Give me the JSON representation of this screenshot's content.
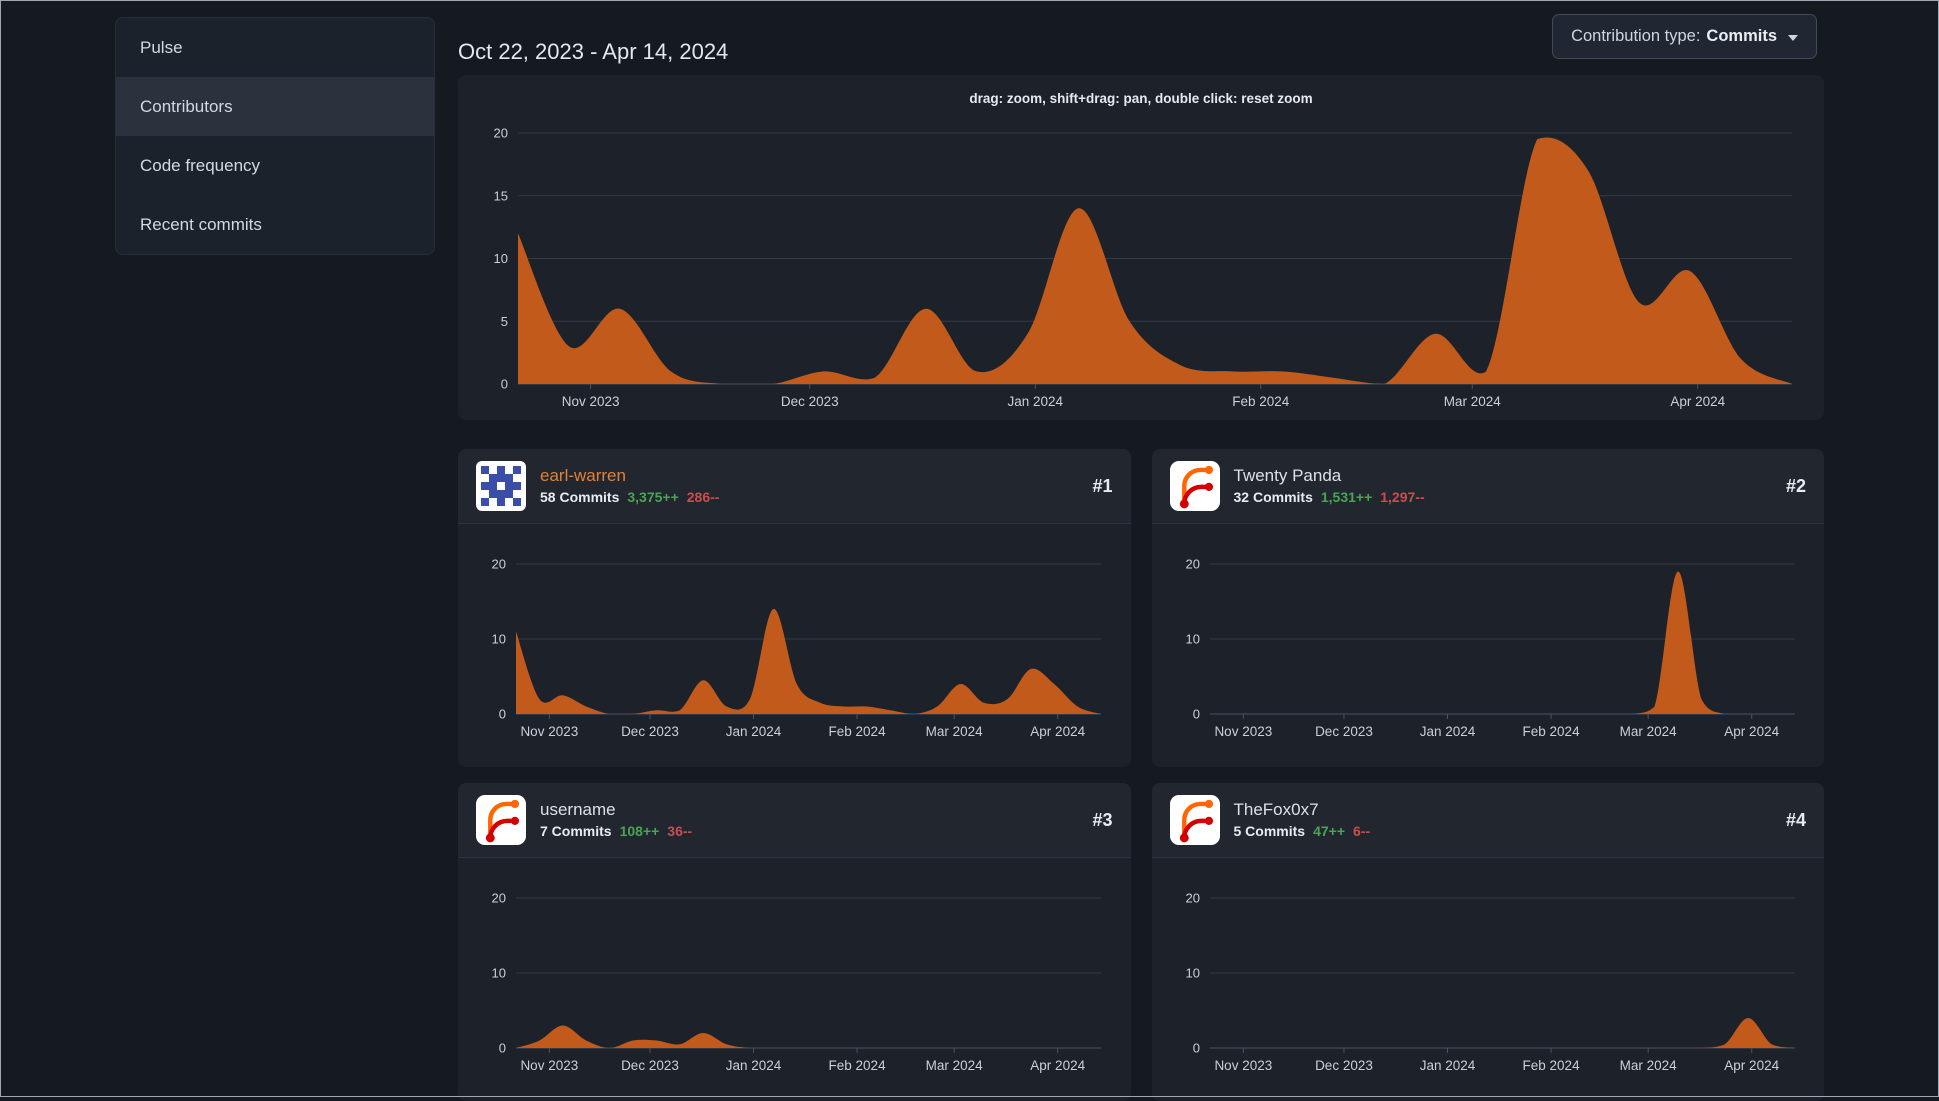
{
  "sidebar": {
    "items": [
      {
        "label": "Pulse",
        "active": false
      },
      {
        "label": "Contributors",
        "active": true
      },
      {
        "label": "Code frequency",
        "active": false
      },
      {
        "label": "Recent commits",
        "active": false
      }
    ]
  },
  "header": {
    "date_range": "Oct 22, 2023 - Apr 14, 2024",
    "contribution_type": {
      "label": "Contribution type:",
      "value": "Commits"
    }
  },
  "main_chart": {
    "hint": "drag: zoom, shift+drag: pan, double click: reset zoom"
  },
  "contributors": [
    {
      "rank": "#1",
      "name": "earl-warren",
      "name_color": "#e0813c",
      "commits": "58 Commits",
      "additions": "3,375++",
      "deletions": "286--",
      "avatar": "identicon"
    },
    {
      "rank": "#2",
      "name": "Twenty Panda",
      "name_color": "#dbe1e9",
      "commits": "32 Commits",
      "additions": "1,531++",
      "deletions": "1,297--",
      "avatar": "forgejo-logo"
    },
    {
      "rank": "#3",
      "name": "username",
      "name_color": "#dbe1e9",
      "commits": "7 Commits",
      "additions": "108++",
      "deletions": "36--",
      "avatar": "forgejo-logo"
    },
    {
      "rank": "#4",
      "name": "TheFox0x7",
      "name_color": "#dbe1e9",
      "commits": "5 Commits",
      "additions": "47++",
      "deletions": "6--",
      "avatar": "forgejo-logo"
    }
  ],
  "colors": {
    "area_fill": "#c25a1b",
    "additions_green": "#4aa454",
    "deletions_red": "#c94f4f",
    "link_orange": "#e0813c",
    "panel_bg": "#1c212a",
    "page_bg": "#151a21"
  },
  "chart_data": [
    {
      "name": "overall-commits",
      "type": "area",
      "point_interval": "week",
      "ymax": 20,
      "yticks": [
        0,
        5,
        10,
        15,
        20
      ],
      "xticks": [
        {
          "label": "Nov 2023",
          "f": 0.057
        },
        {
          "label": "Dec 2023",
          "f": 0.229
        },
        {
          "label": "Jan 2024",
          "f": 0.406
        },
        {
          "label": "Feb 2024",
          "f": 0.583
        },
        {
          "label": "Mar 2024",
          "f": 0.749
        },
        {
          "label": "Apr 2024",
          "f": 0.926
        }
      ],
      "values": [
        12,
        3,
        6,
        1,
        0,
        0,
        1,
        0.5,
        6,
        1,
        4,
        14,
        5,
        1.5,
        1,
        1,
        0.5,
        0,
        4,
        1,
        19.5,
        17,
        6.5,
        9,
        2,
        0
      ]
    },
    {
      "name": "earl-warren-commits",
      "type": "area",
      "point_interval": "week",
      "ymax": 20,
      "yticks": [
        0,
        10,
        20
      ],
      "xticks": [
        {
          "label": "Nov 2023",
          "f": 0.057
        },
        {
          "label": "Dec 2023",
          "f": 0.229
        },
        {
          "label": "Jan 2024",
          "f": 0.406
        },
        {
          "label": "Feb 2024",
          "f": 0.583
        },
        {
          "label": "Mar 2024",
          "f": 0.749
        },
        {
          "label": "Apr 2024",
          "f": 0.926
        }
      ],
      "values": [
        11,
        2,
        2.5,
        1,
        0,
        0,
        0.5,
        0.5,
        4.5,
        1,
        2,
        14,
        4,
        1.5,
        1,
        1,
        0.5,
        0,
        1,
        4,
        1.5,
        2,
        6,
        4,
        1,
        0
      ]
    },
    {
      "name": "twenty-panda-commits",
      "type": "area",
      "point_interval": "week",
      "ymax": 20,
      "yticks": [
        0,
        10,
        20
      ],
      "xticks": [
        {
          "label": "Nov 2023",
          "f": 0.057
        },
        {
          "label": "Dec 2023",
          "f": 0.229
        },
        {
          "label": "Jan 2024",
          "f": 0.406
        },
        {
          "label": "Feb 2024",
          "f": 0.583
        },
        {
          "label": "Mar 2024",
          "f": 0.749
        },
        {
          "label": "Apr 2024",
          "f": 0.926
        }
      ],
      "values": [
        0,
        0,
        0,
        0,
        0,
        0,
        0,
        0,
        0,
        0,
        0,
        0,
        0,
        0,
        0,
        0,
        0,
        0,
        0,
        1,
        19,
        2,
        0,
        0,
        0,
        0
      ]
    },
    {
      "name": "username-commits",
      "type": "area",
      "point_interval": "week",
      "ymax": 20,
      "yticks": [
        0,
        10,
        20
      ],
      "xticks": [
        {
          "label": "Nov 2023",
          "f": 0.057
        },
        {
          "label": "Dec 2023",
          "f": 0.229
        },
        {
          "label": "Jan 2024",
          "f": 0.406
        },
        {
          "label": "Feb 2024",
          "f": 0.583
        },
        {
          "label": "Mar 2024",
          "f": 0.749
        },
        {
          "label": "Apr 2024",
          "f": 0.926
        }
      ],
      "values": [
        0,
        1,
        3,
        1,
        0,
        1,
        1,
        0.5,
        2,
        0.5,
        0,
        0,
        0,
        0,
        0,
        0,
        0,
        0,
        0,
        0,
        0,
        0,
        0,
        0,
        0,
        0
      ]
    },
    {
      "name": "thefox0x7-commits",
      "type": "area",
      "point_interval": "week",
      "ymax": 20,
      "yticks": [
        0,
        10,
        20
      ],
      "xticks": [
        {
          "label": "Nov 2023",
          "f": 0.057
        },
        {
          "label": "Dec 2023",
          "f": 0.229
        },
        {
          "label": "Jan 2024",
          "f": 0.406
        },
        {
          "label": "Feb 2024",
          "f": 0.583
        },
        {
          "label": "Mar 2024",
          "f": 0.749
        },
        {
          "label": "Apr 2024",
          "f": 0.926
        }
      ],
      "values": [
        0,
        0,
        0,
        0,
        0,
        0,
        0,
        0,
        0,
        0,
        0,
        0,
        0,
        0,
        0,
        0,
        0,
        0,
        0,
        0,
        0,
        0,
        0.5,
        4,
        0.5,
        0
      ]
    }
  ]
}
